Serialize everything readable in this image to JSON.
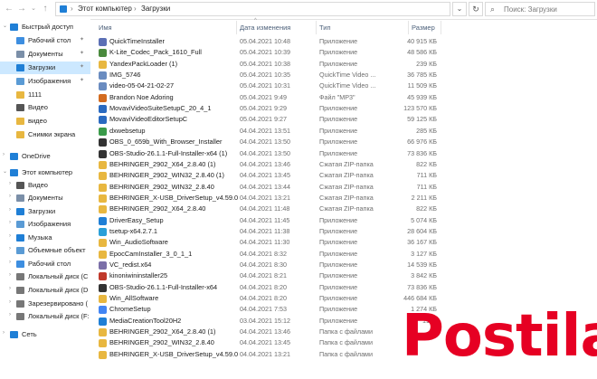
{
  "address_bar": {
    "crumbs": [
      "Этот компьютер",
      "Загрузки"
    ],
    "search_placeholder": "Поиск: Загрузки"
  },
  "columns": {
    "name": "Имя",
    "date": "Дата изменения",
    "type": "Тип",
    "size": "Размер"
  },
  "sidebar": [
    {
      "label": "Быстрый доступ",
      "icon": "star-icon",
      "color": "#1f7fd6",
      "level": 0,
      "expand": "v"
    },
    {
      "label": "Рабочий стол",
      "icon": "desktop-icon",
      "color": "#3d8ee0",
      "level": 1,
      "pin": true
    },
    {
      "label": "Документы",
      "icon": "documents-icon",
      "color": "#7b8fa8",
      "level": 1,
      "pin": true
    },
    {
      "label": "Загрузки",
      "icon": "download-icon",
      "color": "#1f7fd6",
      "level": 1,
      "pin": true,
      "selected": true
    },
    {
      "label": "Изображения",
      "icon": "pictures-icon",
      "color": "#5a9bd5",
      "level": 1,
      "pin": true
    },
    {
      "label": "1111",
      "icon": "folder-icon",
      "color": "#e8b740",
      "level": 1
    },
    {
      "label": "Видео",
      "icon": "video-icon",
      "color": "#555",
      "level": 1
    },
    {
      "label": "видео",
      "icon": "folder-icon",
      "color": "#e8b740",
      "level": 1
    },
    {
      "label": "Снимки экрана",
      "icon": "folder-icon",
      "color": "#e8b740",
      "level": 1
    },
    {
      "label": "OneDrive",
      "icon": "cloud-icon",
      "color": "#1f7fd6",
      "level": 0,
      "expand": ">"
    },
    {
      "label": "Этот компьютер",
      "icon": "pc-icon",
      "color": "#1f7fd6",
      "level": 0,
      "expand": "v"
    },
    {
      "label": "Видео",
      "icon": "video-icon",
      "color": "#555",
      "level": 1,
      "expand": ">"
    },
    {
      "label": "Документы",
      "icon": "documents-icon",
      "color": "#7b8fa8",
      "level": 1,
      "expand": ">"
    },
    {
      "label": "Загрузки",
      "icon": "download-icon",
      "color": "#1f7fd6",
      "level": 1,
      "expand": ">"
    },
    {
      "label": "Изображения",
      "icon": "pictures-icon",
      "color": "#5a9bd5",
      "level": 1,
      "expand": ">"
    },
    {
      "label": "Музыка",
      "icon": "music-icon",
      "color": "#1f7fd6",
      "level": 1,
      "expand": ">"
    },
    {
      "label": "Объемные объект",
      "icon": "cube-icon",
      "color": "#5a9bd5",
      "level": 1,
      "expand": ">"
    },
    {
      "label": "Рабочий стол",
      "icon": "desktop-icon",
      "color": "#3d8ee0",
      "level": 1,
      "expand": ">"
    },
    {
      "label": "Локальный диск (С",
      "icon": "drive-icon",
      "color": "#777",
      "level": 1,
      "expand": ">"
    },
    {
      "label": "Локальный диск (D",
      "icon": "drive-icon",
      "color": "#777",
      "level": 1,
      "expand": ">"
    },
    {
      "label": "Зарезервировано (",
      "icon": "drive-icon",
      "color": "#777",
      "level": 1,
      "expand": ">"
    },
    {
      "label": "Локальный диск (F:",
      "icon": "drive-icon",
      "color": "#777",
      "level": 1,
      "expand": ">"
    },
    {
      "label": "Сеть",
      "icon": "network-icon",
      "color": "#1f7fd6",
      "level": 0,
      "expand": ">"
    }
  ],
  "files": [
    {
      "name": "QuickTimeInstaller",
      "date": "05.04.2021 10:48",
      "type": "Приложение",
      "size": "40 915 КБ",
      "color": "#5b6fb5"
    },
    {
      "name": "K-Lite_Codec_Pack_1610_Full",
      "date": "05.04.2021 10:39",
      "type": "Приложение",
      "size": "48 586 КБ",
      "color": "#4a8a3e"
    },
    {
      "name": "YandexPackLoader (1)",
      "date": "05.04.2021 10:38",
      "type": "Приложение",
      "size": "239 КБ",
      "color": "#e8b740"
    },
    {
      "name": "IMG_5746",
      "date": "05.04.2021 10:35",
      "type": "QuickTime Video ...",
      "size": "36 785 КБ",
      "color": "#6a8cc0"
    },
    {
      "name": "video-05-04-21-02-27",
      "date": "05.04.2021 10:31",
      "type": "QuickTime Video ...",
      "size": "11 509 КБ",
      "color": "#6a8cc0"
    },
    {
      "name": "Brandon Noe Adoring",
      "date": "05.04.2021 9:49",
      "type": "Файл \"MP3\"",
      "size": "45 939 КБ",
      "color": "#d36b1f"
    },
    {
      "name": "MovaviVideoSuiteSetupC_20_4_1",
      "date": "05.04.2021 9:29",
      "type": "Приложение",
      "size": "123 570 КБ",
      "color": "#2a6ac0"
    },
    {
      "name": "MovaviVideoEditorSetupC",
      "date": "05.04.2021 9:27",
      "type": "Приложение",
      "size": "59 125 КБ",
      "color": "#2a6ac0"
    },
    {
      "name": "dxwebsetup",
      "date": "04.04.2021 13:51",
      "type": "Приложение",
      "size": "285 КБ",
      "color": "#3a9b4a"
    },
    {
      "name": "OBS_0_659b_With_Browser_Installer",
      "date": "04.04.2021 13:50",
      "type": "Приложение",
      "size": "66 976 КБ",
      "color": "#333"
    },
    {
      "name": "OBS-Studio-26.1.1-Full-Installer-x64 (1)",
      "date": "04.04.2021 13:50",
      "type": "Приложение",
      "size": "73 836 КБ",
      "color": "#333"
    },
    {
      "name": "BEHRINGER_2902_X64_2.8.40 (1)",
      "date": "04.04.2021 13:46",
      "type": "Сжатая ZIP-папка",
      "size": "822 КБ",
      "color": "#e8b740"
    },
    {
      "name": "BEHRINGER_2902_WIN32_2.8.40 (1)",
      "date": "04.04.2021 13:45",
      "type": "Сжатая ZIP-папка",
      "size": "711 КБ",
      "color": "#e8b740"
    },
    {
      "name": "BEHRINGER_2902_WIN32_2.8.40",
      "date": "04.04.2021 13:44",
      "type": "Сжатая ZIP-папка",
      "size": "711 КБ",
      "color": "#e8b740"
    },
    {
      "name": "BEHRINGER_X-USB_DriverSetup_v4.59.0",
      "date": "04.04.2021 13:21",
      "type": "Сжатая ZIP-папка",
      "size": "2 211 КБ",
      "color": "#e8b740"
    },
    {
      "name": "BEHRINGER_2902_X64_2.8.40",
      "date": "04.04.2021 11:48",
      "type": "Сжатая ZIP-папка",
      "size": "822 КБ",
      "color": "#e8b740"
    },
    {
      "name": "DriverEasy_Setup",
      "date": "04.04.2021 11:45",
      "type": "Приложение",
      "size": "5 074 КБ",
      "color": "#1f7fd6"
    },
    {
      "name": "tsetup-x64.2.7.1",
      "date": "04.04.2021 11:38",
      "type": "Приложение",
      "size": "28 604 КБ",
      "color": "#2a9fd8"
    },
    {
      "name": "Win_AudioSoftware",
      "date": "04.04.2021 11:30",
      "type": "Приложение",
      "size": "36 167 КБ",
      "color": "#e8b740"
    },
    {
      "name": "EpocCamInstaller_3_0_1_1",
      "date": "04.04.2021 8:32",
      "type": "Приложение",
      "size": "3 127 КБ",
      "color": "#e8b740"
    },
    {
      "name": "VC_redist.x64",
      "date": "04.04.2021 8:30",
      "type": "Приложение",
      "size": "14 539 КБ",
      "color": "#7b6fa8"
    },
    {
      "name": "kinoniwininstaller25",
      "date": "04.04.2021 8:21",
      "type": "Приложение",
      "size": "3 842 КБ",
      "color": "#c0392b"
    },
    {
      "name": "OBS-Studio-26.1.1-Full-Installer-x64",
      "date": "04.04.2021 8:20",
      "type": "Приложение",
      "size": "73 836 КБ",
      "color": "#333"
    },
    {
      "name": "Win_AllSoftware",
      "date": "04.04.2021 8:20",
      "type": "Приложение",
      "size": "446 684 КБ",
      "color": "#e8b740"
    },
    {
      "name": "ChromeSetup",
      "date": "04.04.2021 7:53",
      "type": "Приложение",
      "size": "1 274 КБ",
      "color": "#4285f4"
    },
    {
      "name": "MediaCreationTool20H2",
      "date": "03.04.2021 15:12",
      "type": "Приложение",
      "size": "19 ...",
      "color": "#1f7fd6"
    },
    {
      "name": "BEHRINGER_2902_X64_2.8.40 (1)",
      "date": "04.04.2021 13:46",
      "type": "Папка с файлами",
      "size": "",
      "color": "#e8b740"
    },
    {
      "name": "BEHRINGER_2902_WIN32_2.8.40",
      "date": "04.04.2021 13:45",
      "type": "Папка с файлами",
      "size": "",
      "color": "#e8b740"
    },
    {
      "name": "BEHRINGER_X-USB_DriverSetup_v4.59.0",
      "date": "04.04.2021 13:21",
      "type": "Папка с файлами",
      "size": "",
      "color": "#e8b740"
    }
  ],
  "watermark": {
    "text": "Postila",
    "color": "#e60023"
  }
}
